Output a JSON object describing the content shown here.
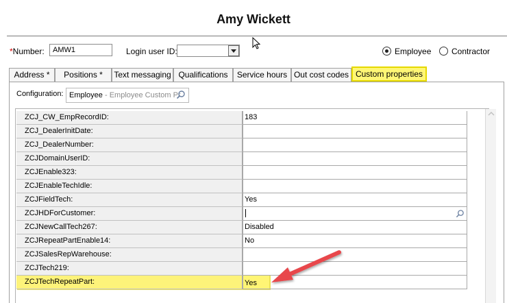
{
  "window": {
    "title": "Amy Wickett"
  },
  "header": {
    "required_mark": "*",
    "number_label": "Number:",
    "number_value": "AMW1",
    "login_label": "Login user ID:",
    "login_value": "",
    "radio_employee": "Employee",
    "radio_contractor": "Contractor",
    "selected": "Employee"
  },
  "tabs": [
    {
      "label": "Address *"
    },
    {
      "label": "Positions *"
    },
    {
      "label": "Text messaging"
    },
    {
      "label": "Qualifications"
    },
    {
      "label": "Service hours"
    },
    {
      "label": "Out cost codes"
    },
    {
      "label": "Custom properties",
      "active": true
    }
  ],
  "config": {
    "label": "Configuration:",
    "value": "Employee",
    "sub": " - Employee Custom Pr"
  },
  "properties": [
    {
      "name": "ZCJ_CW_EmpRecordID:",
      "value": "183"
    },
    {
      "name": "ZCJ_DealerInitDate:",
      "value": ""
    },
    {
      "name": "ZCJ_DealerNumber:",
      "value": ""
    },
    {
      "name": "ZCJDomainUserID:",
      "value": ""
    },
    {
      "name": "ZCJEnable323:",
      "value": ""
    },
    {
      "name": "ZCJEnableTechIdle:",
      "value": ""
    },
    {
      "name": "ZCJFieldTech:",
      "value": "Yes"
    },
    {
      "name": "ZCJHDForCustomer:",
      "value": ""
    },
    {
      "name": "ZCJNewCallTech267:",
      "value": "Disabled"
    },
    {
      "name": "ZCJRepeatPartEnable14:",
      "value": "No"
    },
    {
      "name": "ZCJSalesRepWarehouse:",
      "value": ""
    },
    {
      "name": "ZCJTech219:",
      "value": ""
    },
    {
      "name": "ZCJTechRepeatPart:",
      "value": "Yes"
    }
  ],
  "colors": {
    "highlight": "#fff575",
    "arrow": "#e8474b",
    "required": "#d00000"
  }
}
